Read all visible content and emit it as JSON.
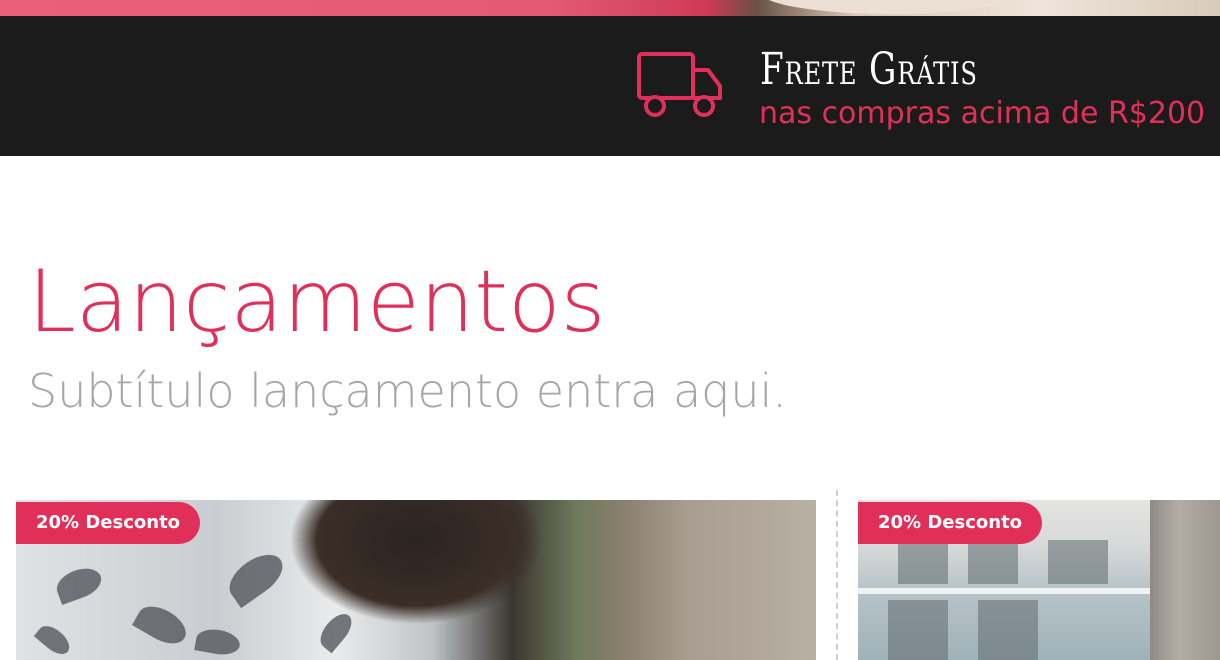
{
  "promo": {
    "title": "Frete Grátis",
    "subtitle": "nas compras acima de R$200",
    "icon": "truck-icon"
  },
  "section": {
    "title": "Lançamentos",
    "subtitle": "Subtítulo lançamento entra aqui."
  },
  "products": [
    {
      "badge": "20% Desconto"
    },
    {
      "badge": "20% Desconto"
    }
  ],
  "colors": {
    "accent": "#e0305a",
    "promo_bg": "#1b1b1b",
    "subtitle_gray": "#a5a5a5"
  }
}
